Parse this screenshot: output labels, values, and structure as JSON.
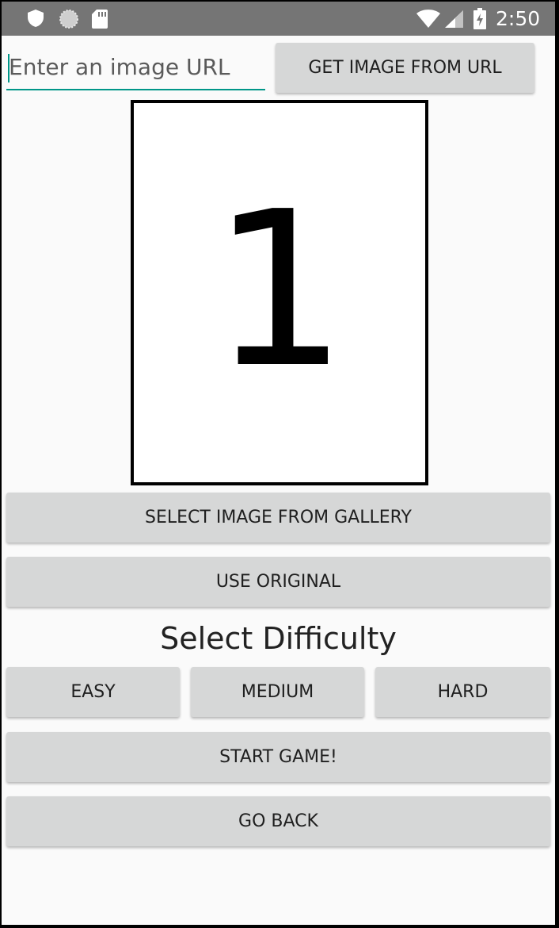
{
  "status_bar": {
    "time": "2:50",
    "icons": [
      "shield-icon",
      "sync-icon",
      "sd-card-icon",
      "wifi-icon",
      "cellular-icon",
      "battery-charging-icon"
    ]
  },
  "url_input": {
    "placeholder": "Enter an image URL",
    "value": ""
  },
  "buttons": {
    "get_image_from_url": "GET IMAGE FROM URL",
    "select_from_gallery": "SELECT IMAGE FROM GALLERY",
    "use_original": "USE ORIGINAL",
    "easy": "EASY",
    "medium": "MEDIUM",
    "hard": "HARD",
    "start_game": "START GAME!",
    "go_back": "GO BACK"
  },
  "image_preview": {
    "content": "1"
  },
  "difficulty": {
    "title": "Select Difficulty"
  },
  "colors": {
    "status_bar": "#757575",
    "accent": "#009688",
    "button_bg": "#d6d7d7",
    "background": "#fafafa"
  }
}
